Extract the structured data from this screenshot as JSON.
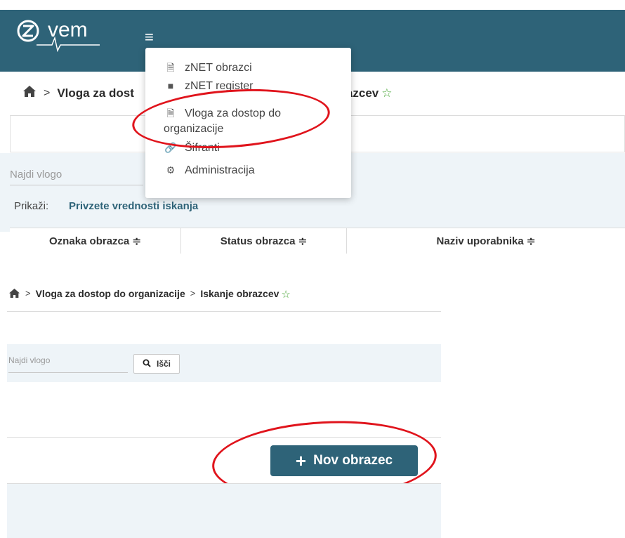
{
  "top": {
    "logo_text": "vem",
    "hamburger_icon": "≡",
    "breadcrumb": {
      "home_icon": "home-icon",
      "separator": ">",
      "item1": "Vloga za dost",
      "item2_tail": "azcev",
      "star": "☆"
    },
    "search_placeholder": "Najdi vlogo",
    "show_label": "Prikaži:",
    "show_link": "Privzete vrednosti iskanja",
    "table_headers": [
      "Oznaka obrazca ≑",
      "Status obrazca ≑",
      "Naziv uporabnika ≑"
    ],
    "menu": [
      {
        "icon": "document-icon",
        "label": "zNET obrazci"
      },
      {
        "icon": "file-icon",
        "label": "zNET register"
      },
      {
        "icon": "document-icon",
        "label_line1": "Vloga za dostop do",
        "label_line2": "organizacije"
      },
      {
        "icon": "link-icon",
        "label": "Šifranti"
      },
      {
        "icon": "gears-icon",
        "label": "Administracija"
      }
    ]
  },
  "bottom": {
    "breadcrumb": {
      "separator": ">",
      "item1": "Vloga za dostop do organizacije",
      "item2": "Iskanje obrazcev",
      "star": "☆"
    },
    "search_placeholder": "Najdi vlogo",
    "search_button": "Išči",
    "new_button": "Nov obrazec",
    "new_button_icon": "+"
  },
  "colors": {
    "brand": "#2e6378",
    "highlight": "#e0141c",
    "favorite_star": "#4ca83a",
    "panel_bg": "#eef4f8"
  }
}
